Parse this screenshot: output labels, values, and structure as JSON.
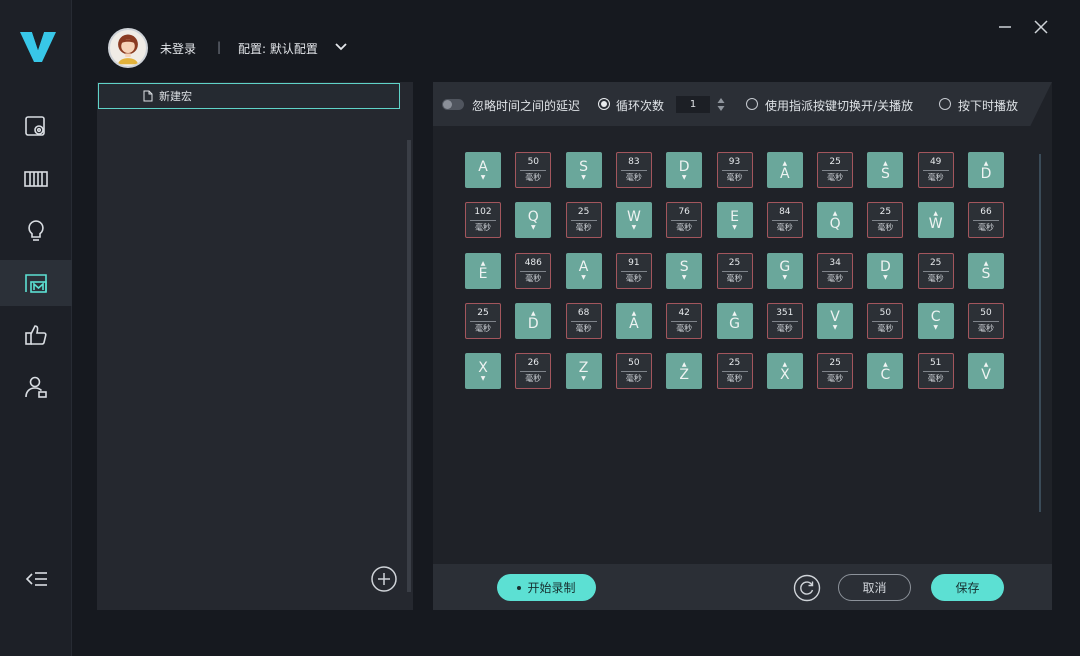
{
  "user": {
    "login_status": "未登录",
    "separator": "|"
  },
  "config": {
    "label": "配置: 默认配置"
  },
  "macro_list": {
    "items": [
      {
        "label": "新建宏"
      }
    ]
  },
  "options": {
    "ignore_delay": {
      "label": "忽略时间之间的延迟",
      "enabled": false
    },
    "loop_count": {
      "label": "循环次数",
      "value": "1",
      "selected": true
    },
    "toggle_key": {
      "label": "使用指派按键切换开/关播放",
      "selected": false
    },
    "hold_play": {
      "label": "按下时播放",
      "selected": false
    }
  },
  "macro_steps": [
    [
      {
        "t": "key",
        "k": "A",
        "d": "down"
      },
      {
        "t": "delay",
        "v": "50",
        "u": "毫秒"
      },
      {
        "t": "key",
        "k": "S",
        "d": "down"
      },
      {
        "t": "delay",
        "v": "83",
        "u": "毫秒"
      },
      {
        "t": "key",
        "k": "D",
        "d": "down"
      },
      {
        "t": "delay",
        "v": "93",
        "u": "毫秒"
      },
      {
        "t": "key",
        "k": "A",
        "d": "up"
      },
      {
        "t": "delay",
        "v": "25",
        "u": "毫秒"
      },
      {
        "t": "key",
        "k": "S",
        "d": "up"
      },
      {
        "t": "delay",
        "v": "49",
        "u": "毫秒"
      },
      {
        "t": "key",
        "k": "D",
        "d": "up"
      }
    ],
    [
      {
        "t": "delay",
        "v": "102",
        "u": "毫秒"
      },
      {
        "t": "key",
        "k": "Q",
        "d": "down"
      },
      {
        "t": "delay",
        "v": "25",
        "u": "毫秒"
      },
      {
        "t": "key",
        "k": "W",
        "d": "down"
      },
      {
        "t": "delay",
        "v": "76",
        "u": "毫秒"
      },
      {
        "t": "key",
        "k": "E",
        "d": "down"
      },
      {
        "t": "delay",
        "v": "84",
        "u": "毫秒"
      },
      {
        "t": "key",
        "k": "Q",
        "d": "up"
      },
      {
        "t": "delay",
        "v": "25",
        "u": "毫秒"
      },
      {
        "t": "key",
        "k": "W",
        "d": "up"
      },
      {
        "t": "delay",
        "v": "66",
        "u": "毫秒"
      }
    ],
    [
      {
        "t": "key",
        "k": "E",
        "d": "up"
      },
      {
        "t": "delay",
        "v": "486",
        "u": "毫秒"
      },
      {
        "t": "key",
        "k": "A",
        "d": "down"
      },
      {
        "t": "delay",
        "v": "91",
        "u": "毫秒"
      },
      {
        "t": "key",
        "k": "S",
        "d": "down"
      },
      {
        "t": "delay",
        "v": "25",
        "u": "毫秒"
      },
      {
        "t": "key",
        "k": "G",
        "d": "down"
      },
      {
        "t": "delay",
        "v": "34",
        "u": "毫秒"
      },
      {
        "t": "key",
        "k": "D",
        "d": "down"
      },
      {
        "t": "delay",
        "v": "25",
        "u": "毫秒"
      },
      {
        "t": "key",
        "k": "S",
        "d": "up"
      }
    ],
    [
      {
        "t": "delay",
        "v": "25",
        "u": "毫秒"
      },
      {
        "t": "key",
        "k": "D",
        "d": "up"
      },
      {
        "t": "delay",
        "v": "68",
        "u": "毫秒"
      },
      {
        "t": "key",
        "k": "A",
        "d": "up"
      },
      {
        "t": "delay",
        "v": "42",
        "u": "毫秒"
      },
      {
        "t": "key",
        "k": "G",
        "d": "up"
      },
      {
        "t": "delay",
        "v": "351",
        "u": "毫秒"
      },
      {
        "t": "key",
        "k": "V",
        "d": "down"
      },
      {
        "t": "delay",
        "v": "50",
        "u": "毫秒"
      },
      {
        "t": "key",
        "k": "C",
        "d": "down"
      },
      {
        "t": "delay",
        "v": "50",
        "u": "毫秒"
      }
    ],
    [
      {
        "t": "key",
        "k": "X",
        "d": "down"
      },
      {
        "t": "delay",
        "v": "26",
        "u": "毫秒"
      },
      {
        "t": "key",
        "k": "Z",
        "d": "down"
      },
      {
        "t": "delay",
        "v": "50",
        "u": "毫秒"
      },
      {
        "t": "key",
        "k": "Z",
        "d": "up"
      },
      {
        "t": "delay",
        "v": "25",
        "u": "毫秒"
      },
      {
        "t": "key",
        "k": "X",
        "d": "up"
      },
      {
        "t": "delay",
        "v": "25",
        "u": "毫秒"
      },
      {
        "t": "key",
        "k": "C",
        "d": "up"
      },
      {
        "t": "delay",
        "v": "51",
        "u": "毫秒"
      },
      {
        "t": "key",
        "k": "V",
        "d": "up"
      }
    ]
  ],
  "footer": {
    "record_label": "开始录制",
    "cancel_label": "取消",
    "save_label": "保存"
  },
  "colors": {
    "accent": "#5ce0d3",
    "key_tile": "#6aa79b",
    "delay_border": "#a3565d"
  },
  "icons": {
    "nav": [
      "settings-icon",
      "keyboard-icon",
      "lighting-icon",
      "macro-icon",
      "thumbs-up-icon",
      "account-icon"
    ],
    "active_nav": "macro-icon"
  }
}
